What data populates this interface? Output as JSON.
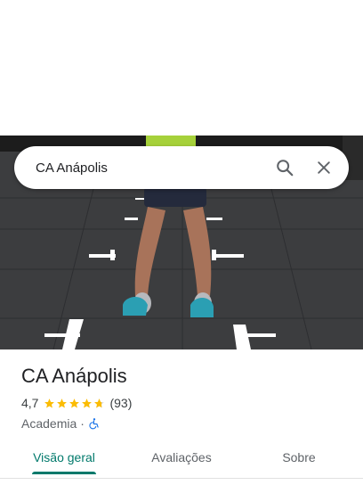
{
  "search": {
    "query": "CA Anápolis"
  },
  "place": {
    "name": "CA Anápolis",
    "rating_text": "4,7",
    "rating": 4.7,
    "review_count": "(93)",
    "category": "Academia",
    "separator": "·",
    "accessibility_icon": "wheelchair-accessible-icon"
  },
  "tabs": [
    {
      "label": "Visão geral",
      "active": true
    },
    {
      "label": "Avaliações",
      "active": false
    },
    {
      "label": "Sobre",
      "active": false
    }
  ],
  "colors": {
    "accent": "#00796b",
    "star": "#fbbc04",
    "accessibility": "#1a73e8"
  },
  "icons": {
    "search": "search-icon",
    "close": "close-icon"
  }
}
